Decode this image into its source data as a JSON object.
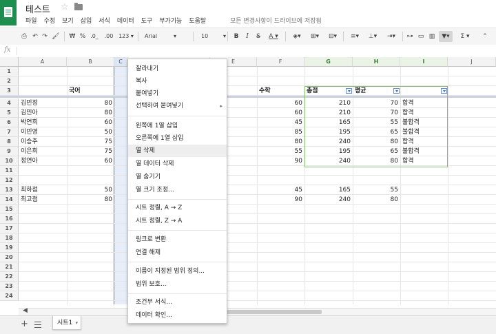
{
  "app": {
    "title": "테스트",
    "save_status": "모든 변경사항이 드라이브에 저장됨"
  },
  "menubar": [
    "파일",
    "수정",
    "보기",
    "삽입",
    "서식",
    "데이터",
    "도구",
    "부가기능",
    "도움말"
  ],
  "toolbar": {
    "currency": "₩",
    "percent": "%",
    "dec_decrease": ".0_",
    "dec_increase": ".00",
    "more_formats": "123",
    "font": "Arial",
    "font_size": "10",
    "bold": "B",
    "italic": "I",
    "strike": "S",
    "text_color": "A",
    "sigma": "Σ"
  },
  "formula_bar": {
    "fx": "fx",
    "value": ""
  },
  "columns": [
    "A",
    "B",
    "C",
    "D",
    "E",
    "F",
    "G",
    "H",
    "I",
    "J"
  ],
  "rows": [
    "1",
    "2",
    "3",
    "4",
    "5",
    "6",
    "7",
    "8",
    "9",
    "10",
    "11",
    "12",
    "13",
    "14",
    "15",
    "16",
    "17",
    "18",
    "19",
    "20",
    "21",
    "22",
    "23",
    "24"
  ],
  "sheet_cells": {
    "r3": {
      "B": "국어",
      "F": "수학",
      "G": "총점",
      "H": "평균"
    },
    "students": [
      {
        "name": "김민정",
        "B": "80",
        "F": "60",
        "G": "210",
        "H": "70",
        "I": "합격"
      },
      {
        "name": "김민아",
        "B": "80",
        "F": "60",
        "G": "210",
        "H": "70",
        "I": "합격"
      },
      {
        "name": "박연희",
        "B": "60",
        "F": "45",
        "G": "165",
        "H": "55",
        "I": "불합격"
      },
      {
        "name": "이민영",
        "B": "50",
        "F": "85",
        "G": "195",
        "H": "65",
        "I": "불합격"
      },
      {
        "name": "이승주",
        "B": "75",
        "F": "80",
        "G": "240",
        "H": "80",
        "I": "합격"
      },
      {
        "name": "이은희",
        "B": "75",
        "F": "55",
        "G": "195",
        "H": "65",
        "I": "불합격"
      },
      {
        "name": "정연아",
        "B": "60",
        "F": "90",
        "G": "240",
        "H": "80",
        "I": "합격"
      }
    ],
    "r13": {
      "A": "최하점",
      "B": "50",
      "F": "45",
      "G": "165",
      "H": "55"
    },
    "r14": {
      "A": "최고점",
      "B": "80",
      "F": "90",
      "G": "240",
      "H": "80"
    }
  },
  "context_menu": {
    "items": [
      "잘라내기",
      "복사",
      "붙여넣기",
      "선택하여 붙여넣기",
      "왼쪽에 1열 삽입",
      "오른쪽에 1열 삽입",
      "열 삭제",
      "열 데이터 삭제",
      "열 숨기기",
      "열 크기 조정...",
      "시트 정렬, A → Z",
      "시트 정렬, Z → A",
      "링크로 변환",
      "연결 해제",
      "이름이 지정된 범위 정의...",
      "범위 보호...",
      "조건부 서식...",
      "데이터 확인..."
    ],
    "highlighted": "열 삭제",
    "submenu_arrow": "▸"
  },
  "sheet_tabs": {
    "add": "+",
    "active": "시트1",
    "dropdown": "▾"
  },
  "colors": {
    "brand": "#1e8e4f",
    "selection": "#4d7cc6",
    "filter_range": "#7fbf6a"
  }
}
